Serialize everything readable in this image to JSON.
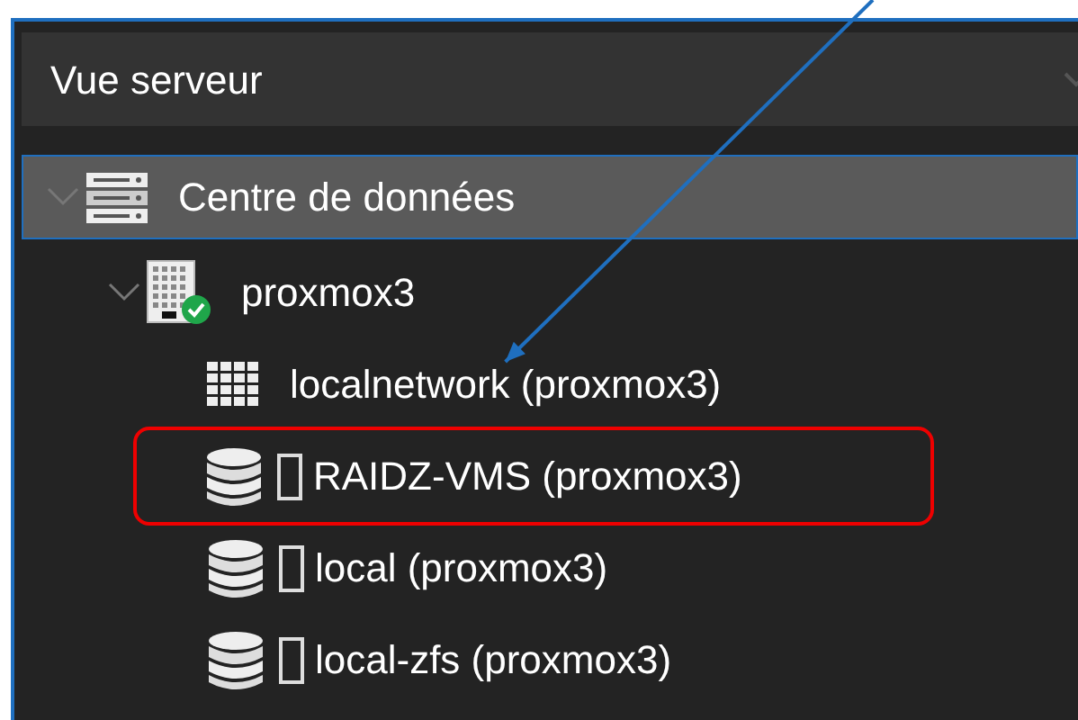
{
  "panel": {
    "title": "Vue serveur"
  },
  "tree": [
    {
      "label": "Centre de données",
      "kind": "datacenter",
      "selected": true,
      "expanded": true,
      "children": [
        {
          "label": "proxmox3",
          "kind": "node",
          "selected": false,
          "expanded": true,
          "online": true,
          "children": [
            {
              "label": "localnetwork (proxmox3)",
              "kind": "network",
              "selected": false,
              "pointed": true,
              "highlighted": false
            },
            {
              "label": "RAIDZ-VMS (proxmox3)",
              "kind": "storage",
              "selected": false,
              "pointed": false,
              "highlighted": true
            },
            {
              "label": "local (proxmox3)",
              "kind": "storage",
              "selected": false,
              "pointed": false,
              "highlighted": false
            },
            {
              "label": "local-zfs (proxmox3)",
              "kind": "storage",
              "selected": false,
              "pointed": false,
              "highlighted": false
            }
          ]
        }
      ]
    }
  ]
}
